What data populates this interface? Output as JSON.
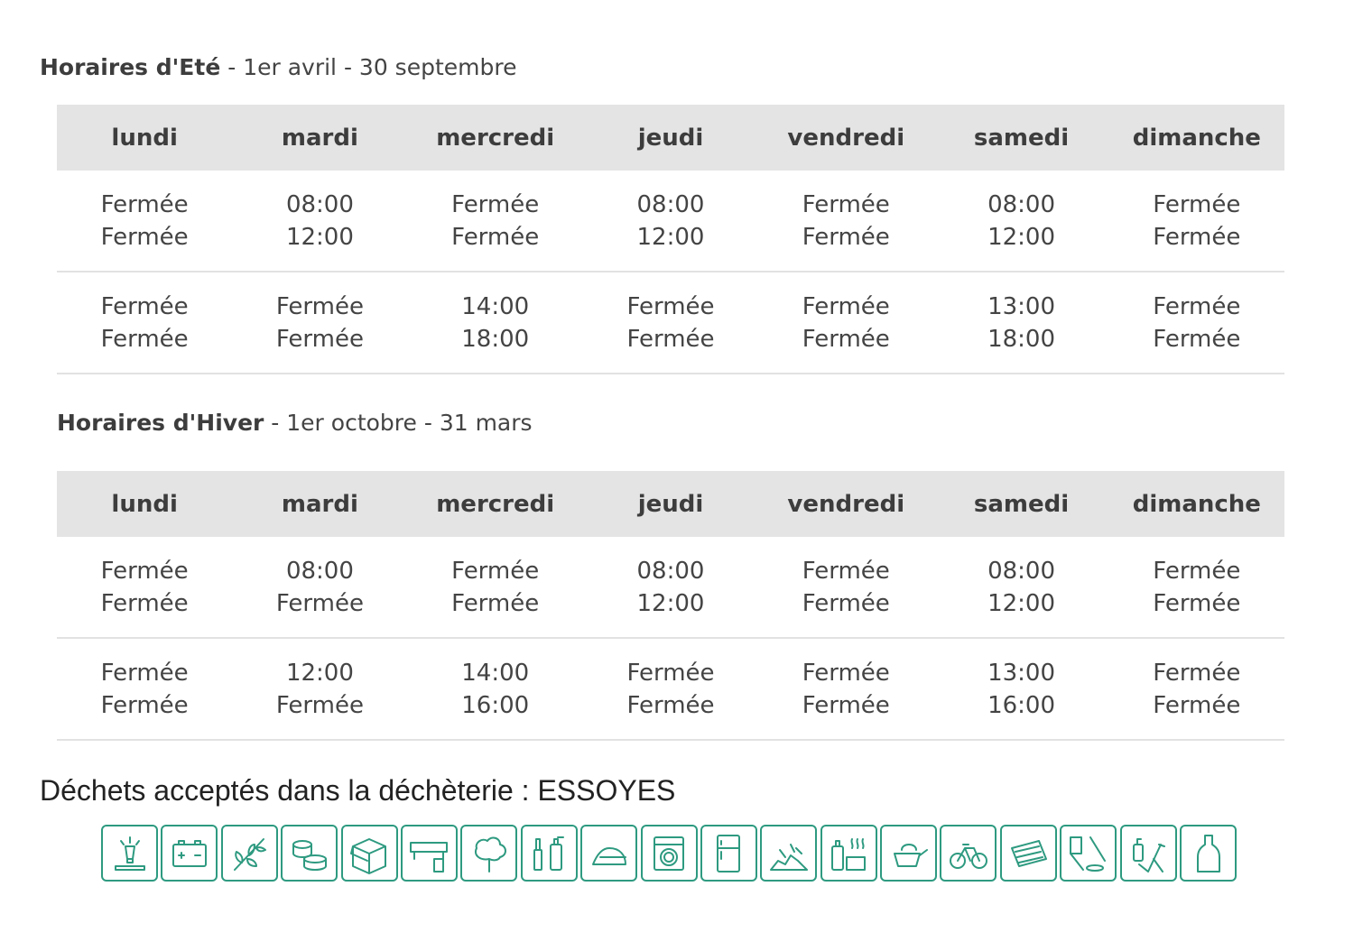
{
  "summer": {
    "title_bold": "Horaires d'Eté",
    "title_rest": " - 1er avril - 30 septembre",
    "days": [
      "lundi",
      "mardi",
      "mercredi",
      "jeudi",
      "vendredi",
      "samedi",
      "dimanche"
    ],
    "rows": [
      [
        [
          "Fermée",
          "Fermée"
        ],
        [
          "08:00",
          "12:00"
        ],
        [
          "Fermée",
          "Fermée"
        ],
        [
          "08:00",
          "12:00"
        ],
        [
          "Fermée",
          "Fermée"
        ],
        [
          "08:00",
          "12:00"
        ],
        [
          "Fermée",
          "Fermée"
        ]
      ],
      [
        [
          "Fermée",
          "Fermée"
        ],
        [
          "Fermée",
          "Fermée"
        ],
        [
          "14:00",
          "18:00"
        ],
        [
          "Fermée",
          "Fermée"
        ],
        [
          "Fermée",
          "Fermée"
        ],
        [
          "13:00",
          "18:00"
        ],
        [
          "Fermée",
          "Fermée"
        ]
      ]
    ]
  },
  "winter": {
    "title_bold": "Horaires d'Hiver",
    "title_rest": " - 1er octobre - 31 mars",
    "days": [
      "lundi",
      "mardi",
      "mercredi",
      "jeudi",
      "vendredi",
      "samedi",
      "dimanche"
    ],
    "rows": [
      [
        [
          "Fermée",
          "Fermée"
        ],
        [
          "08:00",
          "Fermée"
        ],
        [
          "Fermée",
          "Fermée"
        ],
        [
          "08:00",
          "12:00"
        ],
        [
          "Fermée",
          "Fermée"
        ],
        [
          "08:00",
          "12:00"
        ],
        [
          "Fermée",
          "Fermée"
        ]
      ],
      [
        [
          "Fermée",
          "Fermée"
        ],
        [
          "12:00",
          "Fermée"
        ],
        [
          "14:00",
          "16:00"
        ],
        [
          "Fermée",
          "Fermée"
        ],
        [
          "Fermée",
          "Fermée"
        ],
        [
          "13:00",
          "16:00"
        ],
        [
          "Fermée",
          "Fermée"
        ]
      ]
    ]
  },
  "waste": {
    "title": "Déchets acceptés dans la déchèterie : ESSOYES",
    "accent_color": "#2e9a80",
    "icons": [
      "lamp-icon",
      "battery-icon",
      "green-waste-icon",
      "cans-icon",
      "cardboard-icon",
      "gutter-icon",
      "tree-icon",
      "paint-icon",
      "iron-icon",
      "washing-machine-icon",
      "fridge-icon",
      "rubble-icon",
      "chemicals-icon",
      "cooking-oil-icon",
      "bicycle-icon",
      "papers-icon",
      "toxic-products-icon",
      "tools-icon",
      "glass-bottle-icon"
    ]
  }
}
